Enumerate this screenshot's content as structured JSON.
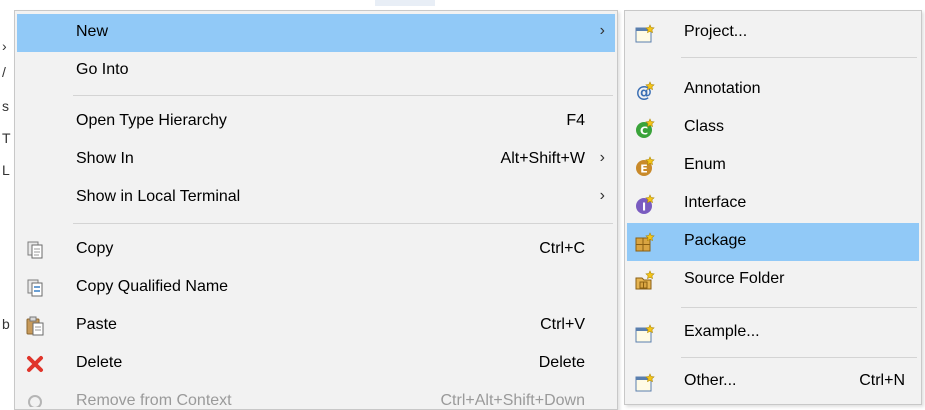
{
  "context_menu": {
    "items": [
      {
        "label": "New",
        "accel": "",
        "submenu": true,
        "icon": "none",
        "highlighted": true
      },
      {
        "label": "Go Into",
        "accel": "",
        "submenu": false,
        "icon": "none"
      },
      {
        "label": "Open Type Hierarchy",
        "accel": "F4",
        "submenu": false,
        "icon": "none"
      },
      {
        "label": "Show In",
        "accel": "Alt+Shift+W",
        "submenu": true,
        "icon": "none"
      },
      {
        "label": "Show in Local Terminal",
        "accel": "",
        "submenu": true,
        "icon": "none"
      },
      {
        "label": "Copy",
        "accel": "Ctrl+C",
        "submenu": false,
        "icon": "copy-icon"
      },
      {
        "label": "Copy Qualified Name",
        "accel": "",
        "submenu": false,
        "icon": "copy-qualified-name-icon"
      },
      {
        "label": "Paste",
        "accel": "Ctrl+V",
        "submenu": false,
        "icon": "paste-icon"
      },
      {
        "label": "Delete",
        "accel": "Delete",
        "submenu": false,
        "icon": "delete-icon"
      },
      {
        "label": "Remove from Context",
        "accel": "Ctrl+Alt+Shift+Down",
        "submenu": false,
        "icon": "remove-from-context-icon",
        "disabled": true
      }
    ],
    "arrow_glyph": "›"
  },
  "new_submenu": {
    "items": [
      {
        "label": "Project...",
        "accel": "",
        "icon": "new-project-icon"
      },
      {
        "label": "Annotation",
        "accel": "",
        "icon": "new-annotation-icon"
      },
      {
        "label": "Class",
        "accel": "",
        "icon": "new-class-icon"
      },
      {
        "label": "Enum",
        "accel": "",
        "icon": "new-enum-icon"
      },
      {
        "label": "Interface",
        "accel": "",
        "icon": "new-interface-icon"
      },
      {
        "label": "Package",
        "accel": "",
        "icon": "new-package-icon",
        "highlighted": true
      },
      {
        "label": "Source Folder",
        "accel": "",
        "icon": "new-source-folder-icon"
      },
      {
        "label": "Example...",
        "accel": "",
        "icon": "new-example-icon"
      },
      {
        "label": "Other...",
        "accel": "Ctrl+N",
        "icon": "new-other-icon"
      }
    ]
  },
  "colors": {
    "highlight": "#91c9f7",
    "menu_bg": "#f2f2f2",
    "class_green": "#3aa33a",
    "enum_orange": "#c98a2a",
    "interface_purple": "#7a5cc0",
    "delete_red": "#e0352b"
  },
  "background_glyphs": [
    "›",
    "/",
    "s",
    "T",
    "L",
    "b"
  ]
}
